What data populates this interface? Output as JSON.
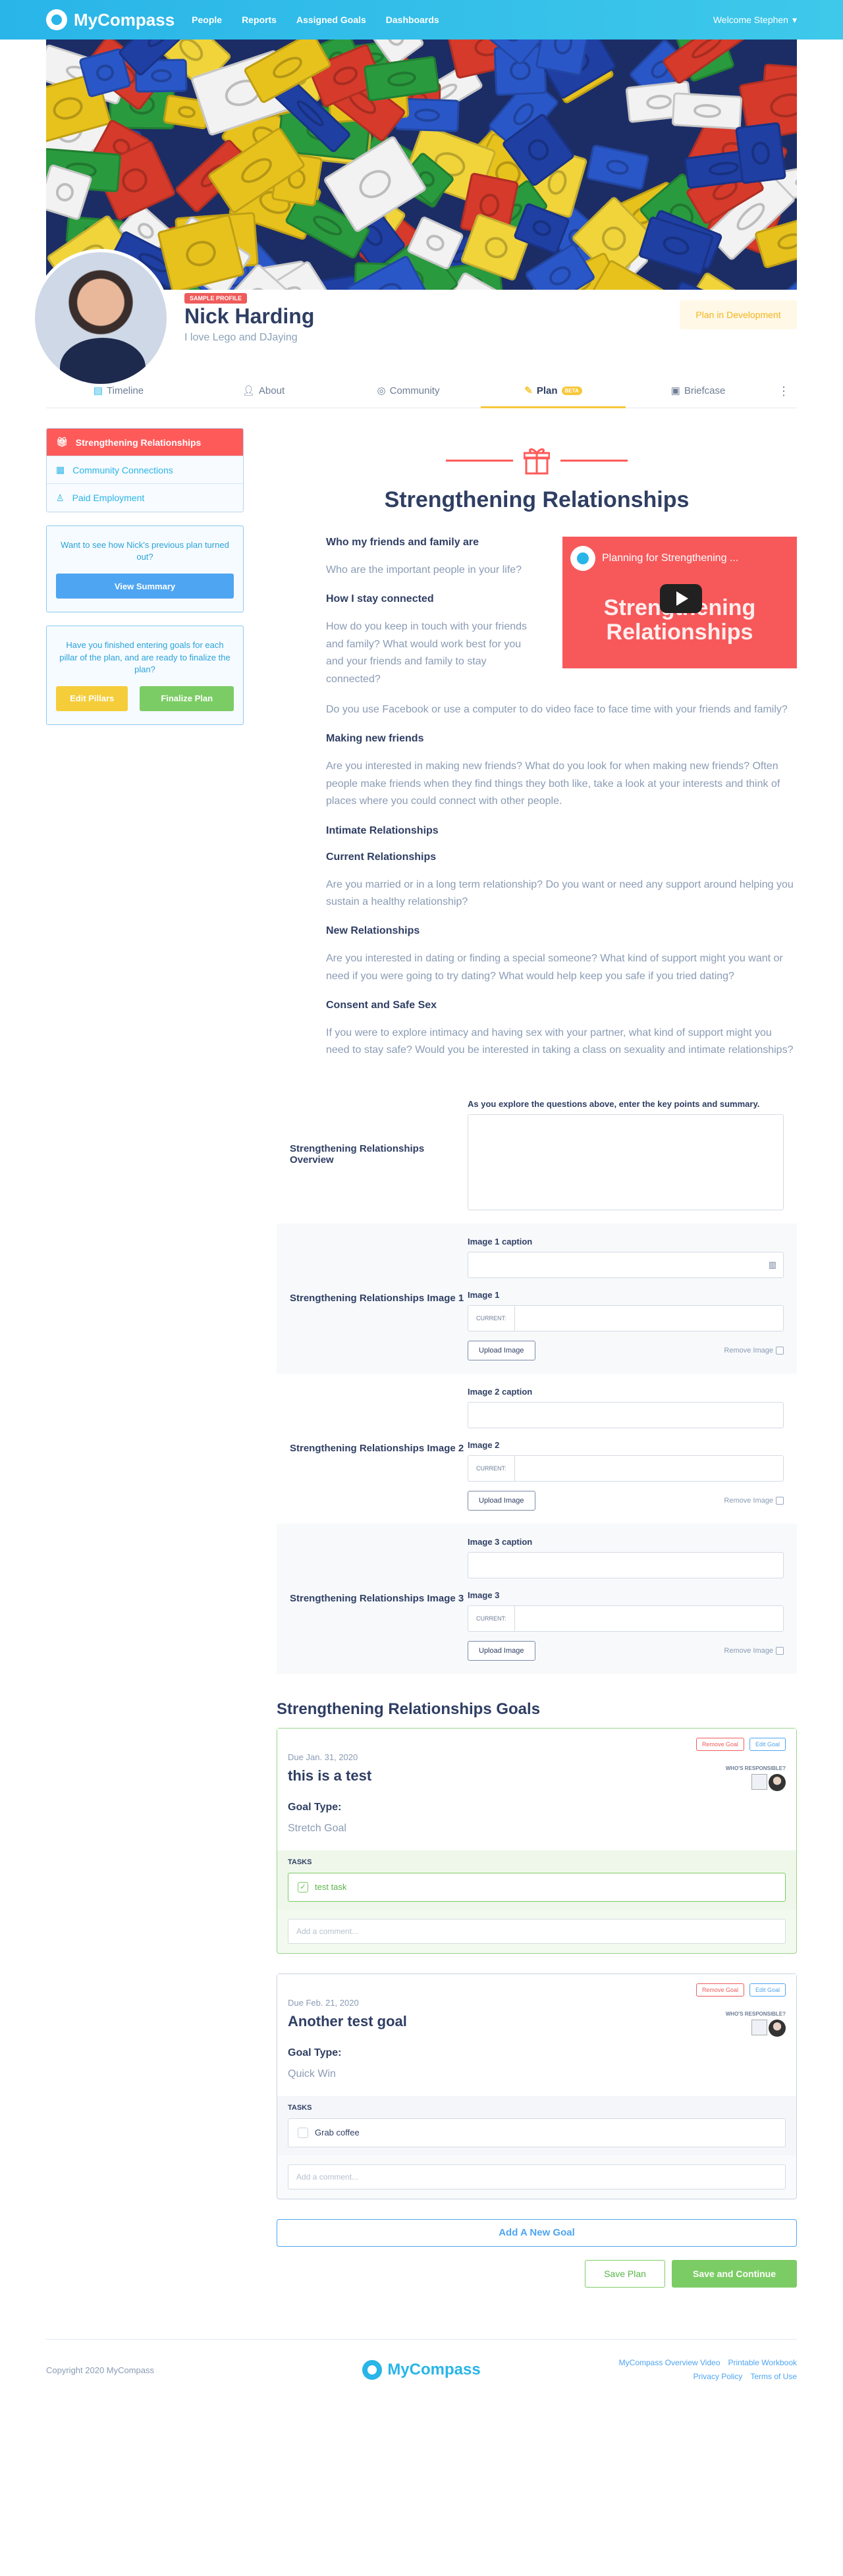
{
  "nav": {
    "brand": "MyCompass",
    "links": [
      "People",
      "Reports",
      "Assigned Goals",
      "Dashboards"
    ],
    "welcome": "Welcome Stephen"
  },
  "profile": {
    "badge": "SAMPLE PROFILE",
    "name": "Nick Harding",
    "tagline": "I love Lego and DJaying",
    "status": "Plan in Development"
  },
  "tabs": [
    {
      "label": "Timeline"
    },
    {
      "label": "About"
    },
    {
      "label": "Community"
    },
    {
      "label": "Plan",
      "badge": "BETA"
    },
    {
      "label": "Briefcase"
    }
  ],
  "sidebar": {
    "items": [
      {
        "label": "Strengthening Relationships"
      },
      {
        "label": "Community Connections"
      },
      {
        "label": "Paid Employment"
      }
    ],
    "summary_card": {
      "text": "Want to see how Nick's previous plan turned out?",
      "button": "View Summary"
    },
    "finish_card": {
      "text": "Have you finished entering goals for each pillar of the plan, and are ready to finalize the plan?",
      "edit_button": "Edit Pillars",
      "finalize_button": "Finalize Plan"
    }
  },
  "section": {
    "title": "Strengthening Relationships",
    "video_title": "Planning for Strengthening ...",
    "video_overlay": "Strengthening Relationships",
    "q1_head": "Who my friends and family are",
    "q1_text": "Who are the important people in your life?",
    "q2_head": "How I stay connected",
    "q2_text_a": "How do you keep in touch with your friends and family? What would work best for you and your friends and family to stay connected?",
    "q2_text_b": "Do you use Facebook or use a computer to do video face to face time with your friends and family?",
    "q3_head": "Making new friends",
    "q3_text": "Are you interested in making new friends? What do you look for when making new friends? Often people make friends when they find things they both like, take a look at your interests and think of places where you could connect with other people.",
    "q4_head": "Intimate Relationships",
    "q5_head": "Current Relationships",
    "q5_text": "Are you married or in a long term relationship? Do you want or need any support around helping you sustain a healthy relationship?",
    "q6_head": "New Relationships",
    "q6_text": "Are you interested in dating or finding a special someone? What kind of support might you want or need if you were going to try dating? What would help keep you safe if you tried dating?",
    "q7_head": "Consent and Safe Sex",
    "q7_text": "If you were to explore intimacy and having sex with your partner, what kind of support might you need to stay safe? Would you be interested in taking a class on sexuality and intimate relationships?"
  },
  "form": {
    "overview_label": "Strengthening Relationships Overview",
    "overview_help": "As you explore the questions above, enter the key points and summary.",
    "current": "CURRENT:",
    "upload": "Upload Image",
    "remove": "Remove Image",
    "images": [
      {
        "label": "Strengthening Relationships Image 1",
        "caption": "Image 1 caption",
        "image": "Image 1"
      },
      {
        "label": "Strengthening Relationships Image 2",
        "caption": "Image 2 caption",
        "image": "Image 2"
      },
      {
        "label": "Strengthening Relationships Image 3",
        "caption": "Image 3 caption",
        "image": "Image 3"
      }
    ]
  },
  "goals": {
    "title": "Strengthening Relationships Goals",
    "remove": "Remove Goal",
    "edit": "Edit Goal",
    "responsible": "WHO'S RESPONSIBLE?",
    "goal_type_label": "Goal Type:",
    "tasks_label": "TASKS",
    "comment_placeholder": "Add a comment...",
    "items": [
      {
        "due": "Due Jan. 31, 2020",
        "name": "this is a test",
        "type": "Stretch Goal",
        "task": "test task"
      },
      {
        "due": "Due Feb. 21, 2020",
        "name": "Another test goal",
        "type": "Quick Win",
        "task": "Grab coffee"
      }
    ],
    "add_button": "Add A New Goal",
    "save_button": "Save Plan",
    "continue_button": "Save and Continue"
  },
  "footer": {
    "copyright": "Copyright 2020 MyCompass",
    "brand": "MyCompass",
    "links": [
      "MyCompass Overview Video",
      "Printable Workbook",
      "Privacy Policy",
      "Terms of Use"
    ]
  }
}
